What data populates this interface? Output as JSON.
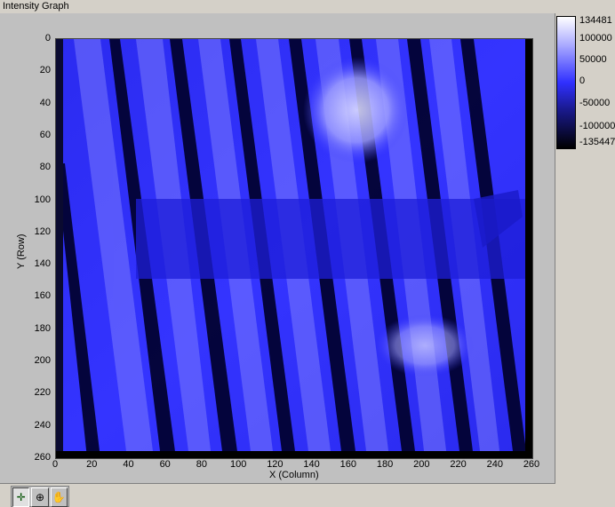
{
  "window": {
    "title": "Intensity Graph"
  },
  "graph": {
    "x_axis_title": "X (Column)",
    "y_axis_title": "Y (Row)",
    "x_ticks": [
      "0",
      "20",
      "40",
      "60",
      "80",
      "100",
      "120",
      "140",
      "160",
      "180",
      "200",
      "220",
      "240",
      "260"
    ],
    "y_ticks": [
      "0",
      "20",
      "40",
      "60",
      "80",
      "100",
      "120",
      "140",
      "160",
      "180",
      "200",
      "220",
      "240",
      "260"
    ]
  },
  "color_scale": {
    "labels": [
      "134481",
      "100000",
      "50000",
      "0",
      "-50000",
      "-100000",
      "-135447"
    ],
    "colors": {
      "max": "#ffffff",
      "mid": "#3030ff",
      "min": "#000000"
    }
  },
  "toolbar": {
    "tools": [
      {
        "name": "cursor-move-tool",
        "icon": "crosshair-icon"
      },
      {
        "name": "zoom-tool",
        "icon": "zoom-icon"
      },
      {
        "name": "pan-tool",
        "icon": "hand-icon"
      }
    ]
  }
}
